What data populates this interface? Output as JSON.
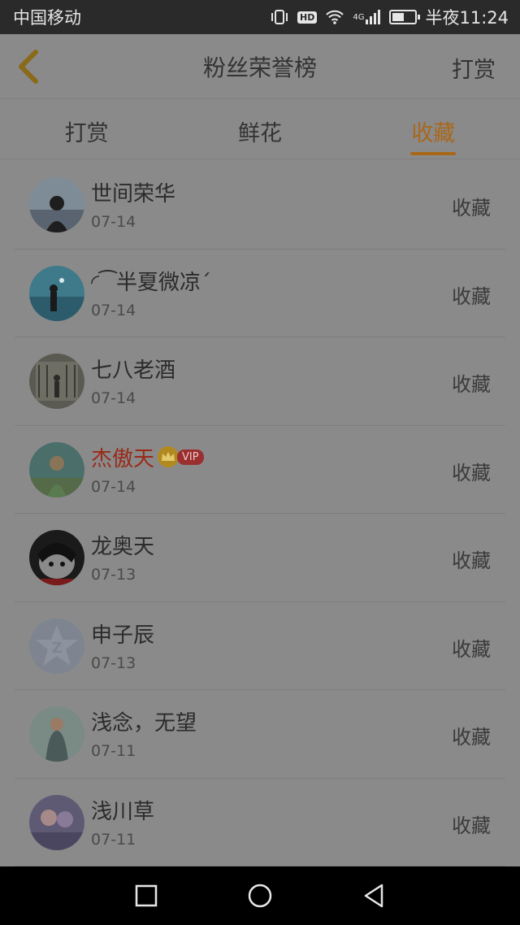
{
  "status": {
    "carrier": "中国移动",
    "time": "半夜11:24",
    "hd": "HD",
    "network": "4G",
    "battery": 0.55
  },
  "nav": {
    "title": "粉丝荣誉榜",
    "action": "打赏"
  },
  "tabs": [
    {
      "label": "打赏",
      "active": false
    },
    {
      "label": "鲜花",
      "active": false
    },
    {
      "label": "收藏",
      "active": true
    }
  ],
  "rows": [
    {
      "name": "世间荣华",
      "date": "07-14",
      "action": "收藏"
    },
    {
      "name": "◜⁀半夏微凉ˊ",
      "date": "07-14",
      "action": "收藏"
    },
    {
      "name": "七八老酒",
      "date": "07-14",
      "action": "收藏"
    },
    {
      "name": "杰傲天",
      "date": "07-14",
      "action": "收藏",
      "vip": "VIP"
    },
    {
      "name": "龙奥天",
      "date": "07-13",
      "action": "收藏"
    },
    {
      "name": "申子辰",
      "date": "07-13",
      "action": "收藏"
    },
    {
      "name": "浅念，无望",
      "date": "07-11",
      "action": "收藏"
    },
    {
      "name": "浅川草",
      "date": "07-11",
      "action": "收藏"
    }
  ]
}
